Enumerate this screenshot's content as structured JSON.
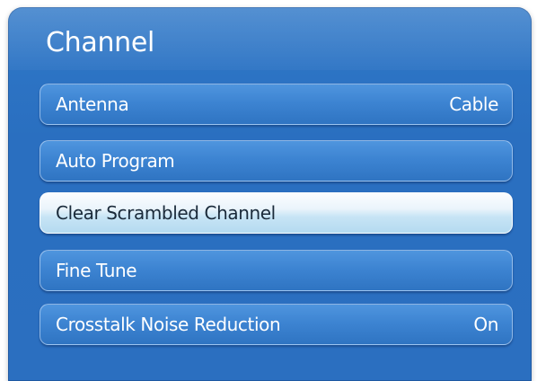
{
  "menu": {
    "title": "Channel",
    "items": [
      {
        "label": "Antenna",
        "value": "Cable"
      },
      {
        "label": "Auto Program",
        "value": ""
      },
      {
        "label": "Clear Scrambled Channel",
        "value": ""
      },
      {
        "label": "Fine Tune",
        "value": ""
      },
      {
        "label": "Crosstalk Noise Reduction",
        "value": "On"
      }
    ]
  },
  "colors": {
    "panel_blue": "#2b6fc0",
    "item_blue": "#3d84d2",
    "highlight": "#c7e4f5"
  }
}
